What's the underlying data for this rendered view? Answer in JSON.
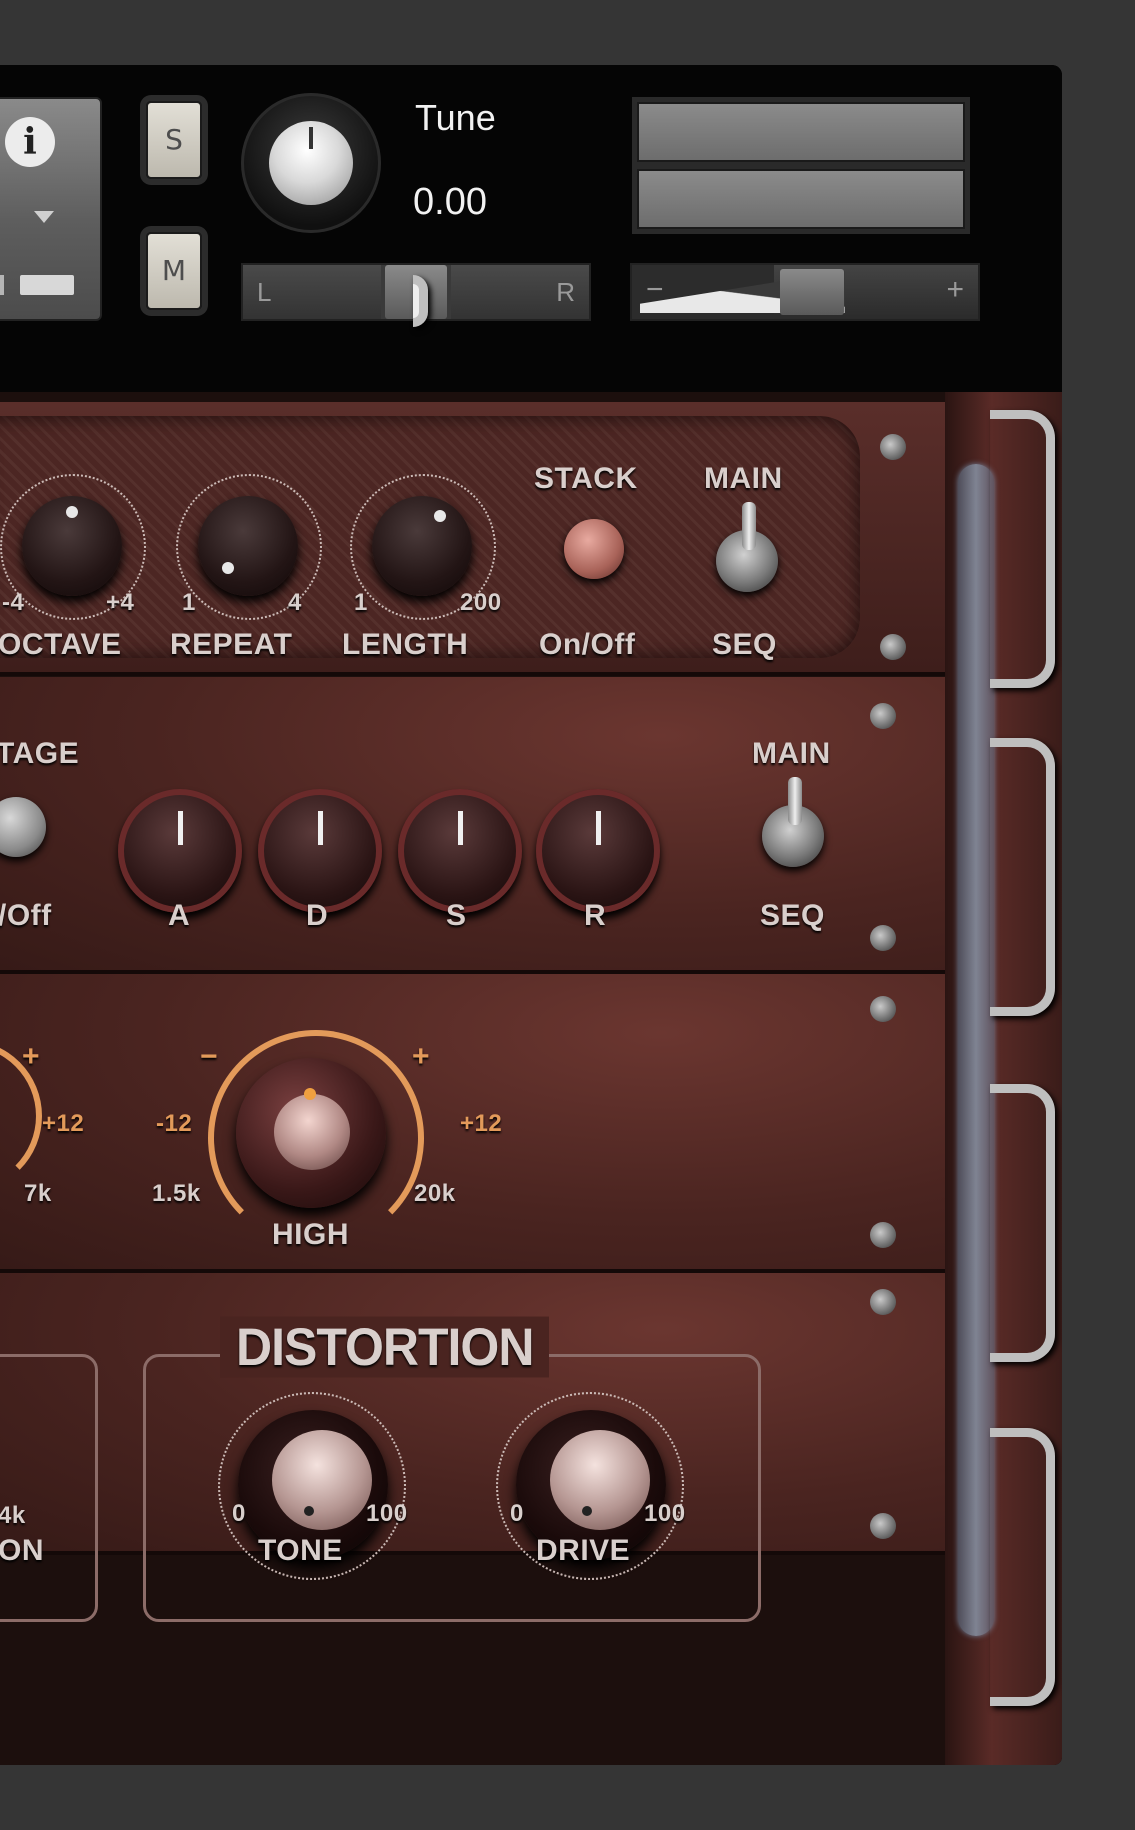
{
  "header": {
    "info_icon": "info-icon",
    "solo_label": "S",
    "mute_label": "M",
    "tune_label": "Tune",
    "tune_value": "0.00",
    "pan_left": "L",
    "pan_right": "R",
    "volume_minus": "−",
    "volume_plus": "+"
  },
  "arp_panel": {
    "octave_min": "-4",
    "octave_max": "+4",
    "octave_label": "OCTAVE",
    "repeat_min": "1",
    "repeat_max": "4",
    "repeat_label": "REPEAT",
    "length_min": "1",
    "length_max": "200",
    "length_label": "LENGTH",
    "stack_label": "STACK",
    "stack_sub": "On/Off",
    "main_label": "MAIN",
    "seq_label": "SEQ"
  },
  "env_panel": {
    "stage_label": "TAGE",
    "onoff_label": "/Off",
    "a_label": "A",
    "d_label": "D",
    "s_label": "S",
    "r_label": "R",
    "main_label": "MAIN",
    "seq_label": "SEQ"
  },
  "eq_panel": {
    "left_plus": "+",
    "left_max": "+12",
    "left_freq": "7k",
    "high_minus": "−",
    "high_plus": "+",
    "high_min": "-12",
    "high_max": "+12",
    "high_freq_min": "1.5k",
    "high_freq_max": "20k",
    "high_label": "HIGH"
  },
  "dist_panel": {
    "left_freq": "4k",
    "left_label": "ON",
    "title": "DISTORTION",
    "tone_min": "0",
    "tone_max": "100",
    "tone_label": "TONE",
    "drive_min": "0",
    "drive_max": "100",
    "drive_label": "DRIVE"
  }
}
